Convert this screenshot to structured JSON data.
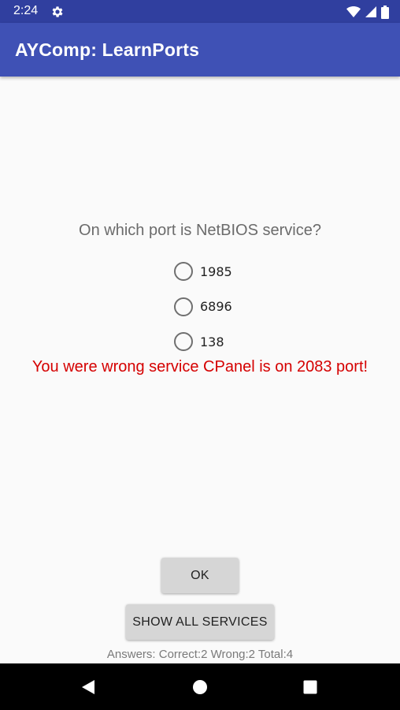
{
  "status_bar": {
    "time": "2:24",
    "icons": [
      "settings-gear-icon",
      "wifi-icon",
      "signal-icon",
      "battery-icon"
    ]
  },
  "app_bar": {
    "title": "AYComp: LearnPorts",
    "color": "#3f51b5",
    "status_color": "#303f9f"
  },
  "quiz": {
    "question": "On which port is NetBIOS service?",
    "options": [
      {
        "label": "1985",
        "selected": false
      },
      {
        "label": "6896",
        "selected": false
      },
      {
        "label": "138",
        "selected": false
      }
    ],
    "feedback": "You were wrong service CPanel is on 2083 port!",
    "feedback_color": "#d50000"
  },
  "buttons": {
    "ok_label": "OK",
    "show_all_label": "SHOW ALL SERVICES"
  },
  "stats": {
    "text": "Answers: Correct:2 Wrong:2 Total:4"
  },
  "nav_bar": {
    "icons": [
      "back-icon",
      "home-icon",
      "recents-icon"
    ]
  }
}
